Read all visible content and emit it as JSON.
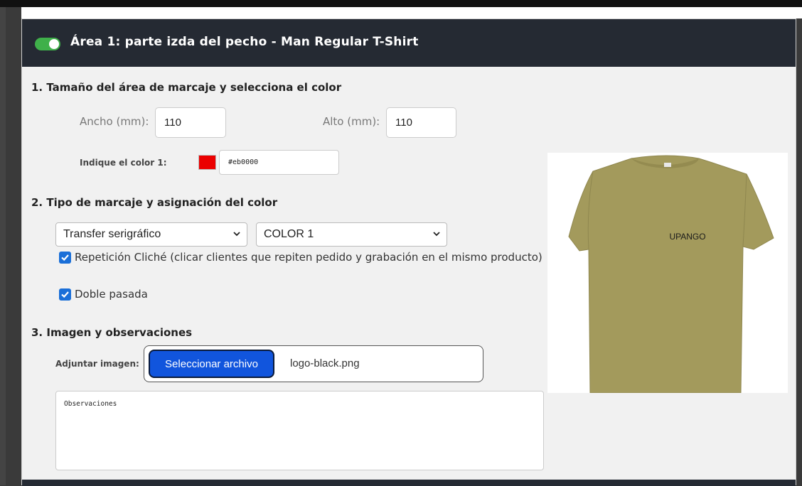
{
  "header": {
    "title": "Área 1: parte izda del pecho - Man Regular T-Shirt",
    "toggle_on": true,
    "toggle_color": "#3fb04a"
  },
  "section1": {
    "title": "1. Tamaño del área de marcaje y selecciona el color",
    "width_label": "Ancho (mm):",
    "width_value": "110",
    "height_label": "Alto (mm):",
    "height_value": "110",
    "color_label": "Indique el color 1:",
    "color_hex": "#eb0000",
    "color_swatch": "#eb0000"
  },
  "section2": {
    "title": "2. Tipo de marcaje y asignación del color",
    "marking_type_selected": "Transfer serigráfico",
    "color_assign_selected": "COLOR 1",
    "checkbox_repeat_label": "Repetición Cliché (clicar clientes que repiten pedido y grabación en el mismo producto)",
    "checkbox_repeat_checked": true,
    "checkbox_double_label": "Doble pasada",
    "checkbox_double_checked": true
  },
  "section3": {
    "title": "3. Imagen y observaciones",
    "attach_label": "Adjuntar imagen:",
    "file_button_label": "Seleccionar archivo",
    "file_name": "logo-black.png",
    "observations_placeholder": "Observaciones"
  },
  "preview": {
    "logo_text": "UPANGO",
    "shirt_color": "#a39a5c",
    "accent_color": "#1155dd"
  }
}
